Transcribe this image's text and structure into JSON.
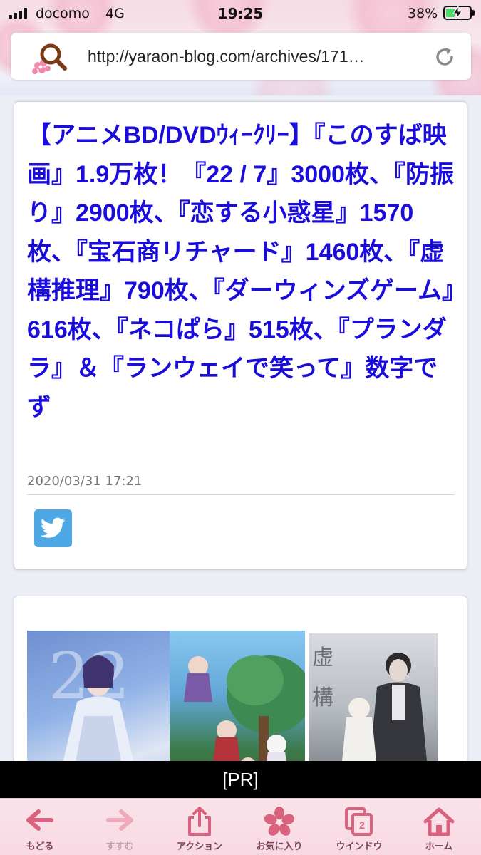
{
  "status_bar": {
    "carrier": "docomo",
    "network": "4G",
    "time": "19:25",
    "battery_percent": "38%",
    "battery_level": 0.38
  },
  "address_bar": {
    "url": "http://yaraon-blog.com/archives/171…"
  },
  "article": {
    "title": "【アニメBD/DVDｳｨｰｸﾘｰ】『このすば映画』1.9万枚！『22 / 7』3000枚、『防振り』2900枚、『恋する小惑星』1570枚、『宝石商リチャード』1460枚、『虚構推理』790枚、『ダーウィンズゲーム』616枚、『ネコぱら』515枚、『プランダラ』＆『ランウェイで笑って』数字でず",
    "date": "2020/03/31 17:21"
  },
  "pr_banner": {
    "label": "[PR]"
  },
  "toolbar": {
    "items": [
      {
        "label": "もどる",
        "icon": "back-arrow-icon"
      },
      {
        "label": "すすむ",
        "icon": "forward-arrow-icon"
      },
      {
        "label": "アクション",
        "icon": "share-icon"
      },
      {
        "label": "お気に入り",
        "icon": "sakura-icon"
      },
      {
        "label": "ウインドウ",
        "icon": "windows-icon",
        "count": "2"
      },
      {
        "label": "ホーム",
        "icon": "home-icon"
      }
    ]
  },
  "colors": {
    "link": "#1a0ddc",
    "toolbar_icon": "#d9627f",
    "twitter": "#4ea8e6"
  }
}
